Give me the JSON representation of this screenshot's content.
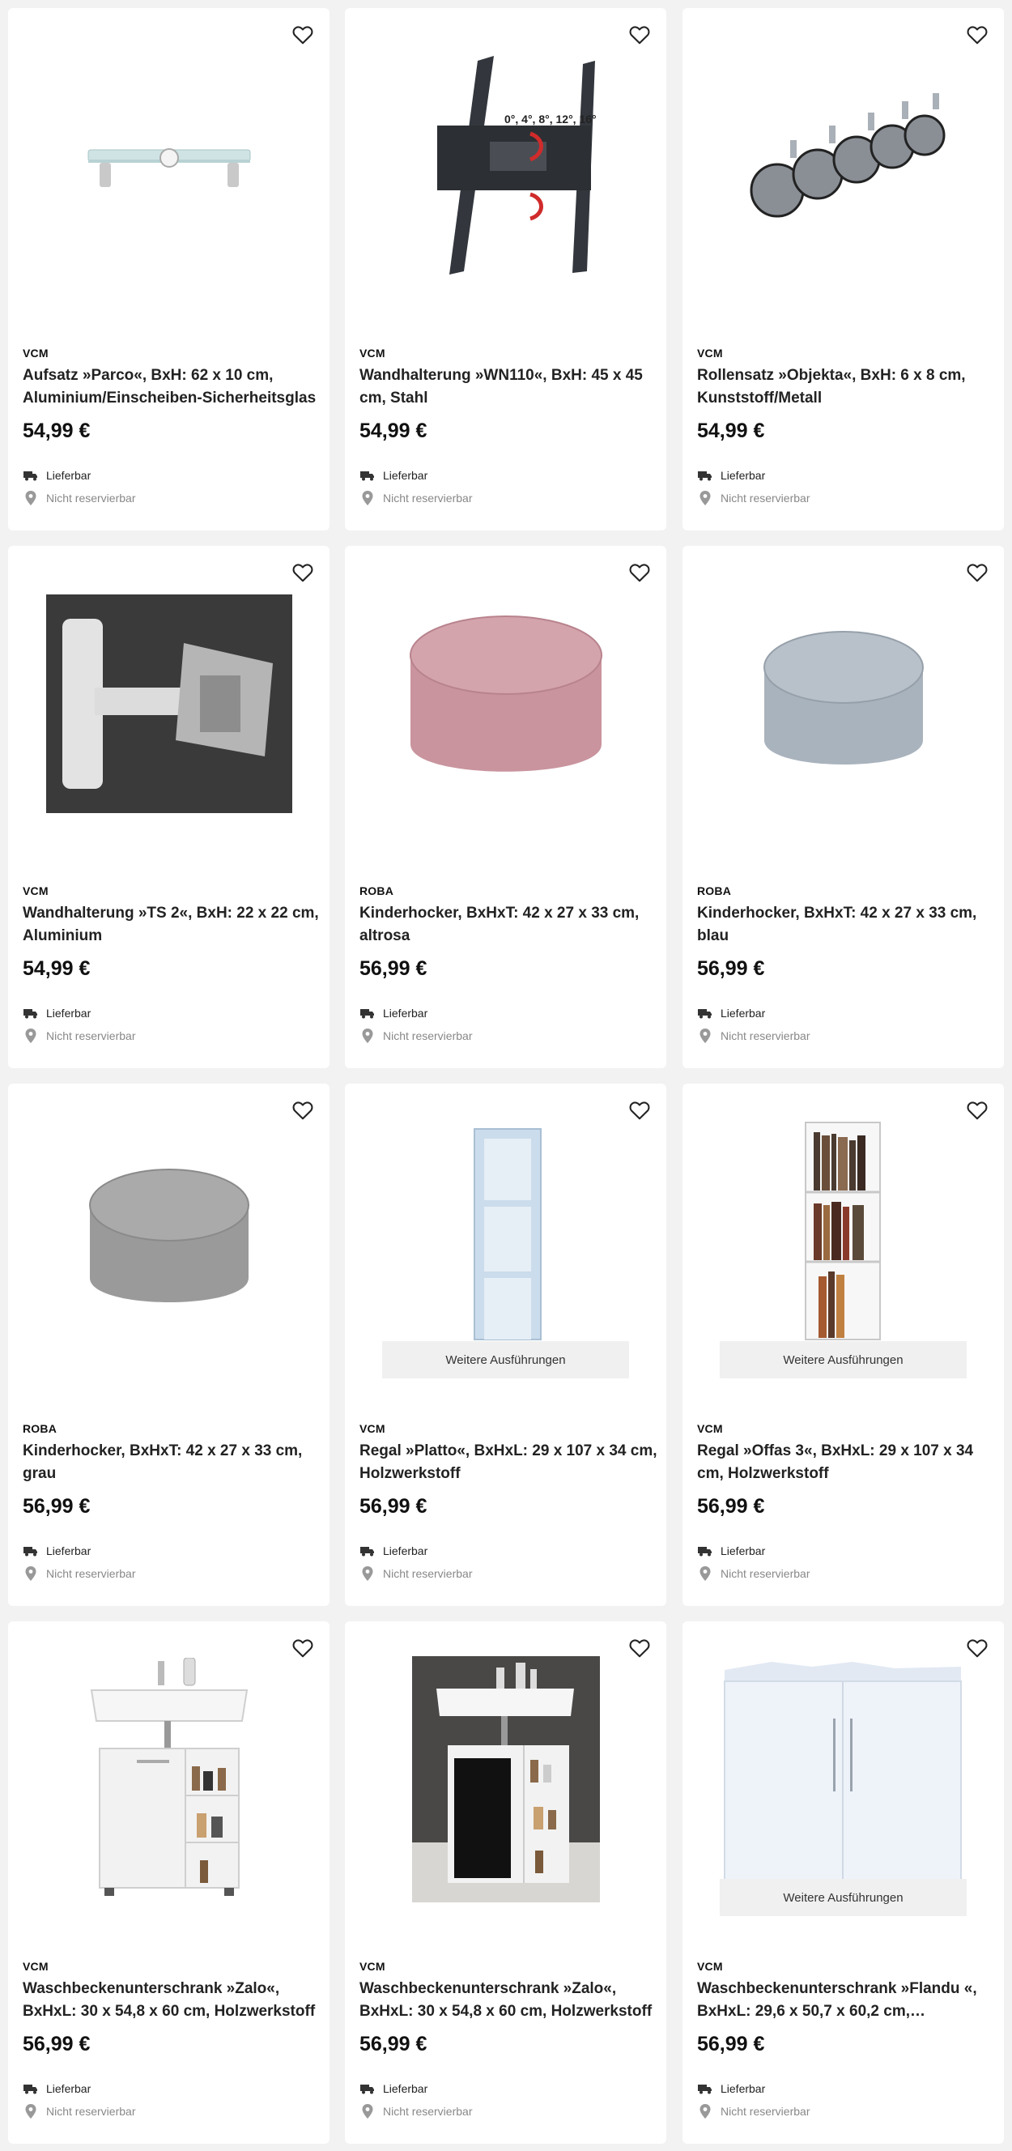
{
  "labels": {
    "delivery": "Lieferbar",
    "reserve": "Nicht reservierbar",
    "more": "Weitere Ausführungen"
  },
  "products": [
    {
      "brand": "VCM",
      "title": "Aufsatz »Parco«, BxH: 62 x 10 cm, Aluminium/Einscheiben-Sicherheitsglas",
      "price": "54,99 €",
      "image": "glass-monitor-stand"
    },
    {
      "brand": "VCM",
      "title": "Wandhalterung »WN110«, BxH: 45 x 45 cm, Stahl",
      "price": "54,99 €",
      "image": "tv-wall-mount",
      "image_text": "0°, 4°, 8°, 12°, 16°"
    },
    {
      "brand": "VCM",
      "title": "Rollensatz »Objekta«, BxH: 6 x 8 cm, Kunststoff/Metall",
      "price": "54,99 €",
      "image": "castor-wheels"
    },
    {
      "brand": "VCM",
      "title": "Wandhalterung »TS 2«, BxH: 22 x 22 cm, Aluminium",
      "price": "54,99 €",
      "image": "swivel-wall-mount"
    },
    {
      "brand": "ROBA",
      "title": "Kinderhocker, BxHxT: 42 x 27 x 33 cm, altrosa",
      "price": "56,99 €",
      "image": "pink-velvet-stool",
      "color": "#c9949e"
    },
    {
      "brand": "ROBA",
      "title": "Kinderhocker, BxHxT: 42 x 27 x 33 cm, blau",
      "price": "56,99 €",
      "image": "blue-velvet-stool",
      "color": "#a9b3bd"
    },
    {
      "brand": "ROBA",
      "title": "Kinderhocker, BxHxT: 42 x 27 x 33 cm, grau",
      "price": "56,99 €",
      "image": "grey-velvet-stool",
      "color": "#9a9a9a"
    },
    {
      "brand": "VCM",
      "title": "Regal »Platto«, BxHxL: 29 x 107 x 34 cm, Holzwerkstoff",
      "price": "56,99 €",
      "image": "light-blue-shelf",
      "more": true
    },
    {
      "brand": "VCM",
      "title": "Regal »Offas 3«, BxHxL: 29 x 107 x 34 cm, Holzwerkstoff",
      "price": "56,99 €",
      "image": "white-bookshelf",
      "more": true
    },
    {
      "brand": "VCM",
      "title": "Waschbeckenunterschrank »Zalo«, BxHxL: 30 x 54,8 x 60 cm, Holzwerkstoff",
      "price": "56,99 €",
      "image": "white-sink-cabinet"
    },
    {
      "brand": "VCM",
      "title": "Waschbeckenunterschrank »Zalo«, BxHxL: 30 x 54,8 x 60 cm, Holzwerkstoff",
      "price": "56,99 €",
      "image": "black-sink-cabinet"
    },
    {
      "brand": "VCM",
      "title": "Waschbeckenunterschrank »Flandu «, BxHxL: 29,6 x 50,7 x 60,2 cm,…",
      "price": "56,99 €",
      "image": "white-two-door-cabinet",
      "more": true
    }
  ]
}
